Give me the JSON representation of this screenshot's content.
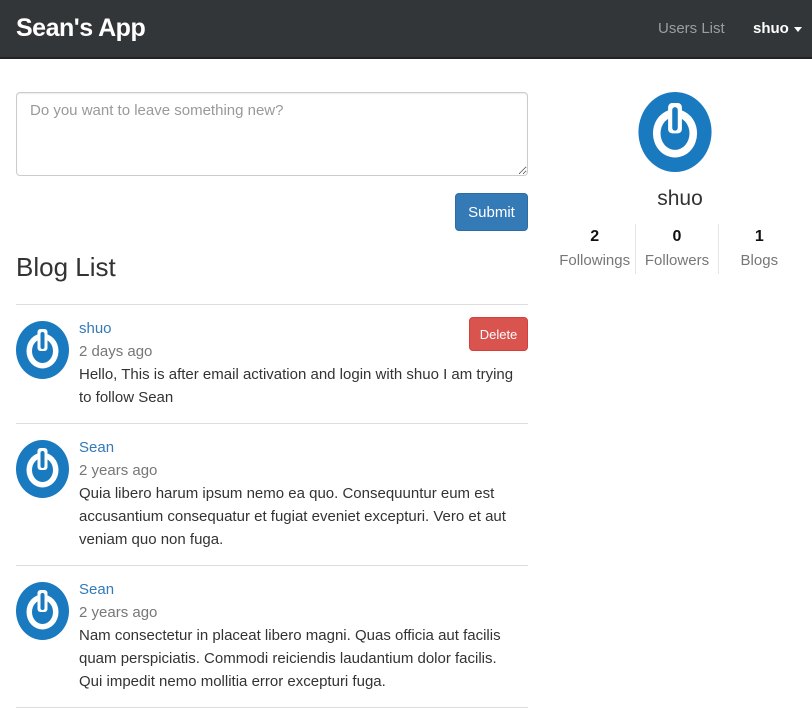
{
  "navbar": {
    "brand": "Sean's App",
    "users_list": "Users List",
    "current_user": "shuo",
    "background": "#323639"
  },
  "composer": {
    "placeholder": "Do you want to leave something new?",
    "value": "",
    "submit_label": "Submit",
    "submit_color": "#337ab7"
  },
  "blog_list": {
    "title": "Blog List",
    "items": [
      {
        "author": "shuo",
        "time": "2 days ago",
        "text": "Hello, This is after email activation and login with shuo I am trying to follow Sean",
        "delete_label": "Delete"
      },
      {
        "author": "Sean",
        "time": "2 years ago",
        "text": "Quia libero harum ipsum nemo ea quo. Consequuntur eum est accusantium consequatur et fugiat eveniet excepturi. Vero et aut veniam quo non fuga."
      },
      {
        "author": "Sean",
        "time": "2 years ago",
        "text": "Nam consectetur in placeat libero magni. Quas officia aut facilis quam perspiciatis. Commodi reiciendis laudantium dolor facilis. Qui impedit nemo mollitia error excepturi fuga."
      }
    ]
  },
  "profile": {
    "name": "shuo",
    "avatar_icon": "power-avatar-icon",
    "avatar_color": "#1a7abf",
    "stats": [
      {
        "count": "2",
        "label": "Followings"
      },
      {
        "count": "0",
        "label": "Followers"
      },
      {
        "count": "1",
        "label": "Blogs"
      }
    ]
  },
  "colors": {
    "link": "#337ab7",
    "danger": "#d9534f",
    "muted": "#777777"
  }
}
